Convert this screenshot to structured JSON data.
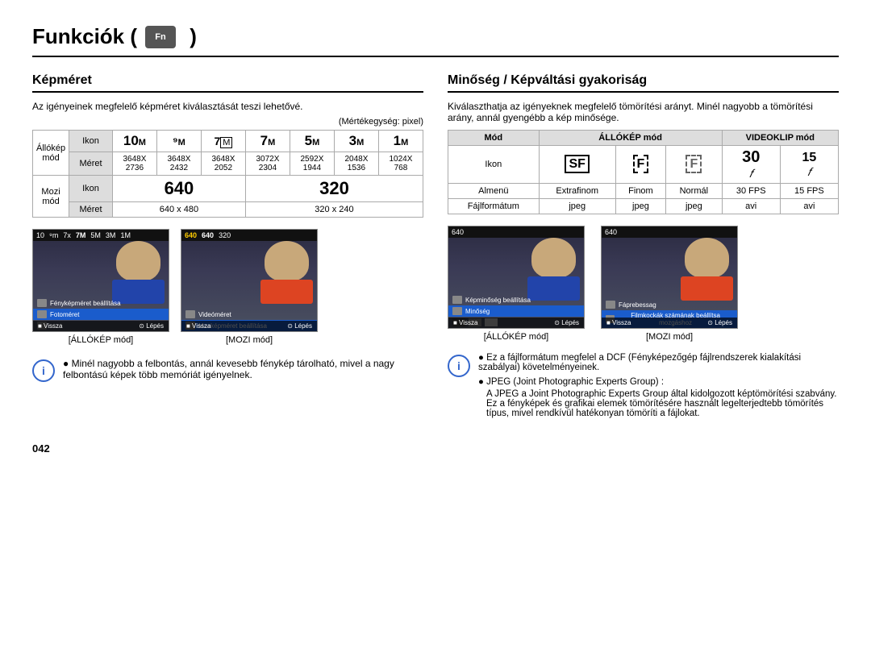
{
  "title": "Funkciók (",
  "camera_icon": "Fn",
  "sections": {
    "left": {
      "title": "Képméret",
      "description": "Az igényeinek megfelelő képméret kiválasztását teszi lehetővé.",
      "unit_label": "(Mértékegység: pixel)",
      "table": {
        "rows": [
          {
            "rowspan_label": "Állókép\nmód",
            "sub_rows": [
              {
                "label": "Ikon",
                "cells": [
                  "10M",
                  "⁹M",
                  "7M",
                  "7M",
                  "5M",
                  "3M",
                  "1M"
                ]
              },
              {
                "label": "Méret",
                "cells": [
                  "3648X\n2736",
                  "3648X\n2432",
                  "3648X\n2052",
                  "3072X\n2304",
                  "2592X\n1944",
                  "2048X\n1536",
                  "1024X\n768"
                ]
              }
            ]
          },
          {
            "rowspan_label": "Mozi mód",
            "sub_rows": [
              {
                "label": "Ikon",
                "cells": [
                  "640",
                  "",
                  "320",
                  ""
                ]
              },
              {
                "label": "Méret",
                "cells": [
                  "640 x 480",
                  "",
                  "320 x 240",
                  ""
                ]
              }
            ]
          }
        ]
      },
      "screens": [
        {
          "caption": "[ÁLLÓKÉP mód]",
          "type": "allokep1"
        },
        {
          "caption": "[MOZI mód]",
          "type": "mozi1"
        }
      ],
      "note": {
        "text": "Minél nagyobb a felbontás, annál kevesebb fénykép tárolható, mivel a nagy felbontású képek több memóriát igényelnek."
      }
    },
    "right": {
      "title": "Minőség / Képváltási gyakoriság",
      "description": "Kiválaszthatja az igényeknek megfelelő tömörítési arányt. Minél nagyobb a tömörítési arány, annál gyengébb a kép minősége.",
      "table": {
        "header": [
          "Mód",
          "ÁLLÓKÉP mód",
          "",
          "VIDEOKLIP mód",
          ""
        ],
        "rows": [
          {
            "label": "Ikon",
            "cells": [
              "SF_icon",
              "F_icon",
              "N_icon",
              "30_icon",
              "15_icon"
            ]
          },
          {
            "label": "Almenü",
            "cells": [
              "Extrafinom",
              "Finom",
              "Normál",
              "30 FPS",
              "15 FPS"
            ]
          },
          {
            "label": "Fájlformátum",
            "cells": [
              "jpeg",
              "jpeg",
              "jpeg",
              "avi",
              "avi"
            ]
          }
        ]
      },
      "screens": [
        {
          "caption": "[ÁLLÓKÉP mód]",
          "type": "allokep2"
        },
        {
          "caption": "[MOZI mód]",
          "type": "mozi2"
        }
      ],
      "notes": [
        "Ez a fájlformátum megfelel a DCF (Fényképezőgép fájlrendszerek kialakítási szabályai) követelményeinek.",
        "JPEG (Joint Photographic Experts Group) :\nA JPEG a Joint Photographic Experts Group által kidolgozott képtömörítési szabvány. Ez a fényképek és grafikai elemek tömörítésére használt legelterjedtebb tömörítés típus, mivel rendkívül hatékonyan tömöríti a fájlokat."
      ]
    }
  },
  "page_number": "042"
}
